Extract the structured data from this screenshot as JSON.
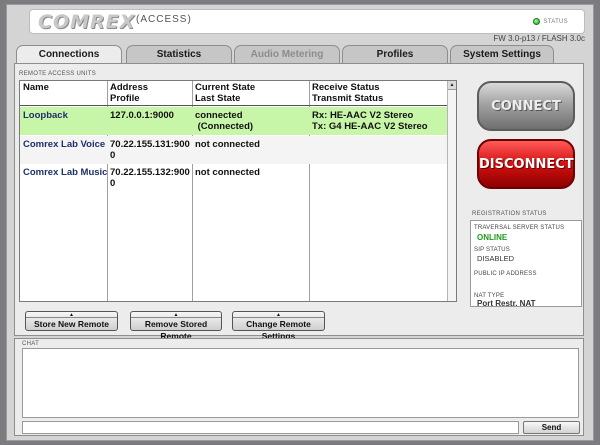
{
  "header": {
    "logo": "COMREX",
    "logo_sub": "(ACCESS)",
    "status_label": "STATUS",
    "firmware": "FW 3.0-p13 / FLASH 3.0c"
  },
  "tabs": [
    {
      "label": "Connections",
      "state": "active"
    },
    {
      "label": "Statistics",
      "state": "normal"
    },
    {
      "label": "Audio Metering",
      "state": "disabled"
    },
    {
      "label": "Profiles",
      "state": "normal"
    },
    {
      "label": "System Settings",
      "state": "normal"
    }
  ],
  "remote_units": {
    "section_label": "REMOTE ACCESS UNITS",
    "columns": [
      {
        "line1": "Name",
        "line2": ""
      },
      {
        "line1": "Address",
        "line2": "Profile"
      },
      {
        "line1": "Current State",
        "line2": "Last State"
      },
      {
        "line1": "Receive Status",
        "line2": "Transmit Status"
      }
    ],
    "rows": [
      {
        "name": "Loopback",
        "address": "127.0.0.1:9000",
        "state": "connected",
        "last_state": " (Connected)",
        "rx": "Rx: HE-AAC V2 Stereo",
        "tx": "Tx: G4 HE-AAC V2 Stereo",
        "selected": true
      },
      {
        "name": "Comrex Lab Voice",
        "address": "70.22.155.131:900",
        "address_wrap": "0",
        "state": "not connected",
        "last_state": "",
        "rx": "",
        "tx": "",
        "selected": false
      },
      {
        "name": "Comrex Lab Music",
        "address": "70.22.155.132:900",
        "address_wrap": "0",
        "state": "not connected",
        "last_state": "",
        "rx": "",
        "tx": "",
        "selected": false
      }
    ],
    "buttons": {
      "store": "Store New Remote",
      "remove": "Remove Stored Remote",
      "change": "Change Remote Settings"
    }
  },
  "actions": {
    "connect": "CONNECT",
    "disconnect": "DISCONNECT"
  },
  "registration": {
    "section_label": "REGISTRATION STATUS",
    "traversal_label": "TRAVERSAL SERVER STATUS",
    "traversal_value": "ONLINE",
    "sip_label": "SIP STATUS",
    "sip_value": "DISABLED",
    "public_ip_label": "PUBLIC IP ADDRESS",
    "public_ip_value": "",
    "nat_label": "NAT TYPE",
    "nat_value": "Port Restr. NAT"
  },
  "chat": {
    "section_label": "CHAT",
    "input_value": "",
    "send_label": "Send"
  },
  "colors": {
    "selected_row": "#c8f6a8",
    "online": "#1d9b1d",
    "disconnect": "#d41010",
    "status_led": "#19a019"
  }
}
